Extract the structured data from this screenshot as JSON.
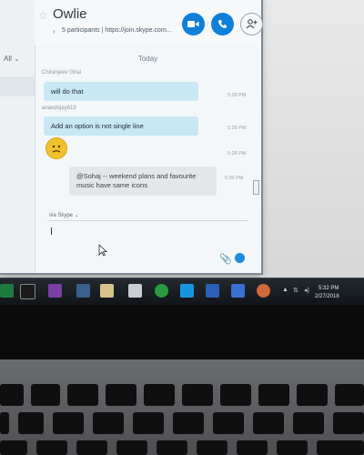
{
  "window": {
    "title": "Owlie",
    "subtitle": "5 participants | https://join.skype.com...",
    "filter_label": "All ⌄"
  },
  "chat": {
    "date_divider": "Today",
    "messages": [
      {
        "sender": "Chiranjeev Ghai",
        "text": "will do that",
        "time": "5:28 PM"
      },
      {
        "sender": "anandojay619",
        "text": "Add an option is not single line",
        "time": "5:28 PM"
      },
      {
        "sender": "",
        "emoji": "confused-face",
        "text": "",
        "time": "5:28 PM"
      },
      {
        "sender": "",
        "text": "@Sohaj -- weekend plans and favourite music have same icons",
        "time": "5:30 PM"
      }
    ],
    "via_label": "via Skype ⌄"
  },
  "taskbar": {
    "clock_time": "5:32 PM",
    "clock_date": "2/27/2018",
    "icons": [
      "excel-icon",
      "cmd-icon",
      "feather-icon",
      "folder-icon",
      "docs-icon",
      "file-icon",
      "chrome-icon",
      "skype-icon",
      "word-icon",
      "app-icon",
      "orange-app-icon"
    ]
  },
  "colors": {
    "accent": "#0f7fd8",
    "bubble_in": "#c7e8f4",
    "bubble_grey": "#e3e7ea"
  }
}
